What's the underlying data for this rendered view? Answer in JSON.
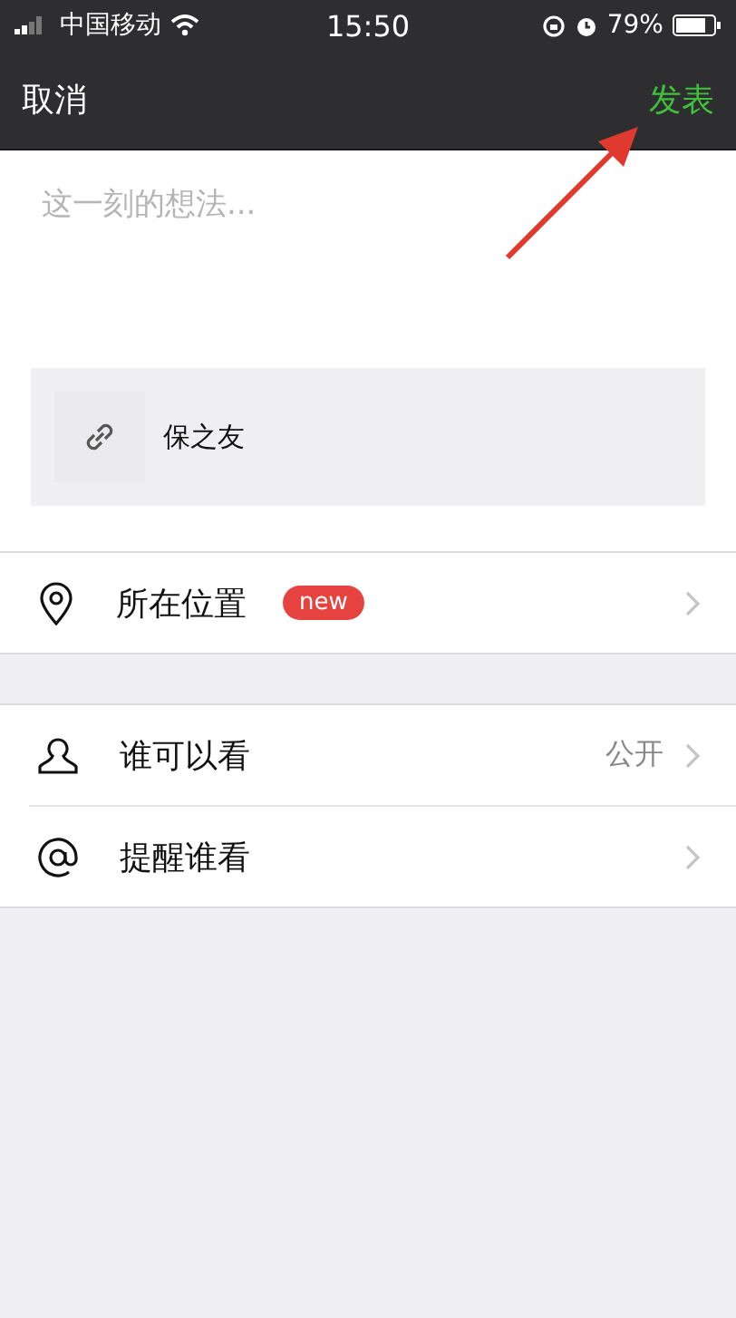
{
  "status_bar": {
    "carrier": "中国移动",
    "time": "15:50",
    "battery": "79%"
  },
  "nav": {
    "cancel": "取消",
    "publish": "发表"
  },
  "composer": {
    "placeholder": "这一刻的想法..."
  },
  "link_card": {
    "title": "保之友"
  },
  "groups": [
    {
      "rows": [
        {
          "label": "所在位置",
          "badge": "new"
        }
      ]
    },
    {
      "rows": [
        {
          "label": "谁可以看",
          "value": "公开"
        },
        {
          "label": "提醒谁看"
        }
      ]
    }
  ]
}
